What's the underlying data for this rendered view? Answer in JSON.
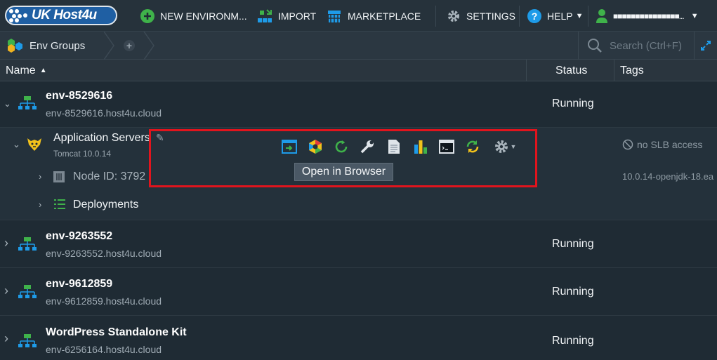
{
  "logo": {
    "text": "UK Host4u"
  },
  "topbar": {
    "new_env": "NEW ENVIRONM...",
    "import": "IMPORT",
    "marketplace": "MARKETPLACE",
    "settings": "SETTINGS",
    "help": "HELP",
    "user": "■■■■■■■■■■■■■■■..."
  },
  "crumb": {
    "env_groups": "Env Groups"
  },
  "search": {
    "placeholder": "Search (Ctrl+F)"
  },
  "table": {
    "headers": {
      "name": "Name",
      "status": "Status",
      "tags": "Tags"
    }
  },
  "envs": [
    {
      "name": "env-8529616",
      "url": "env-8529616.host4u.cloud",
      "status": "Running"
    },
    {
      "name": "env-9263552",
      "url": "env-9263552.host4u.cloud",
      "status": "Running"
    },
    {
      "name": "env-9612859",
      "url": "env-9612859.host4u.cloud",
      "status": "Running"
    },
    {
      "name": "WordPress Standalone Kit",
      "url": "env-6256164.host4u.cloud",
      "status": "Running"
    }
  ],
  "app_servers": {
    "title": "Application Servers",
    "subtitle": "Tomcat 10.0.14",
    "no_slb": "no SLB access",
    "node_id": "Node ID: 3792",
    "tag": "10.0.14-openjdk-18.ea",
    "deployments": "Deployments"
  },
  "tooltip": {
    "text": "Open in Browser"
  },
  "colors": {
    "accent_green": "#3fb24a",
    "accent_blue": "#1e9be8",
    "highlight_red": "#e1141d"
  }
}
